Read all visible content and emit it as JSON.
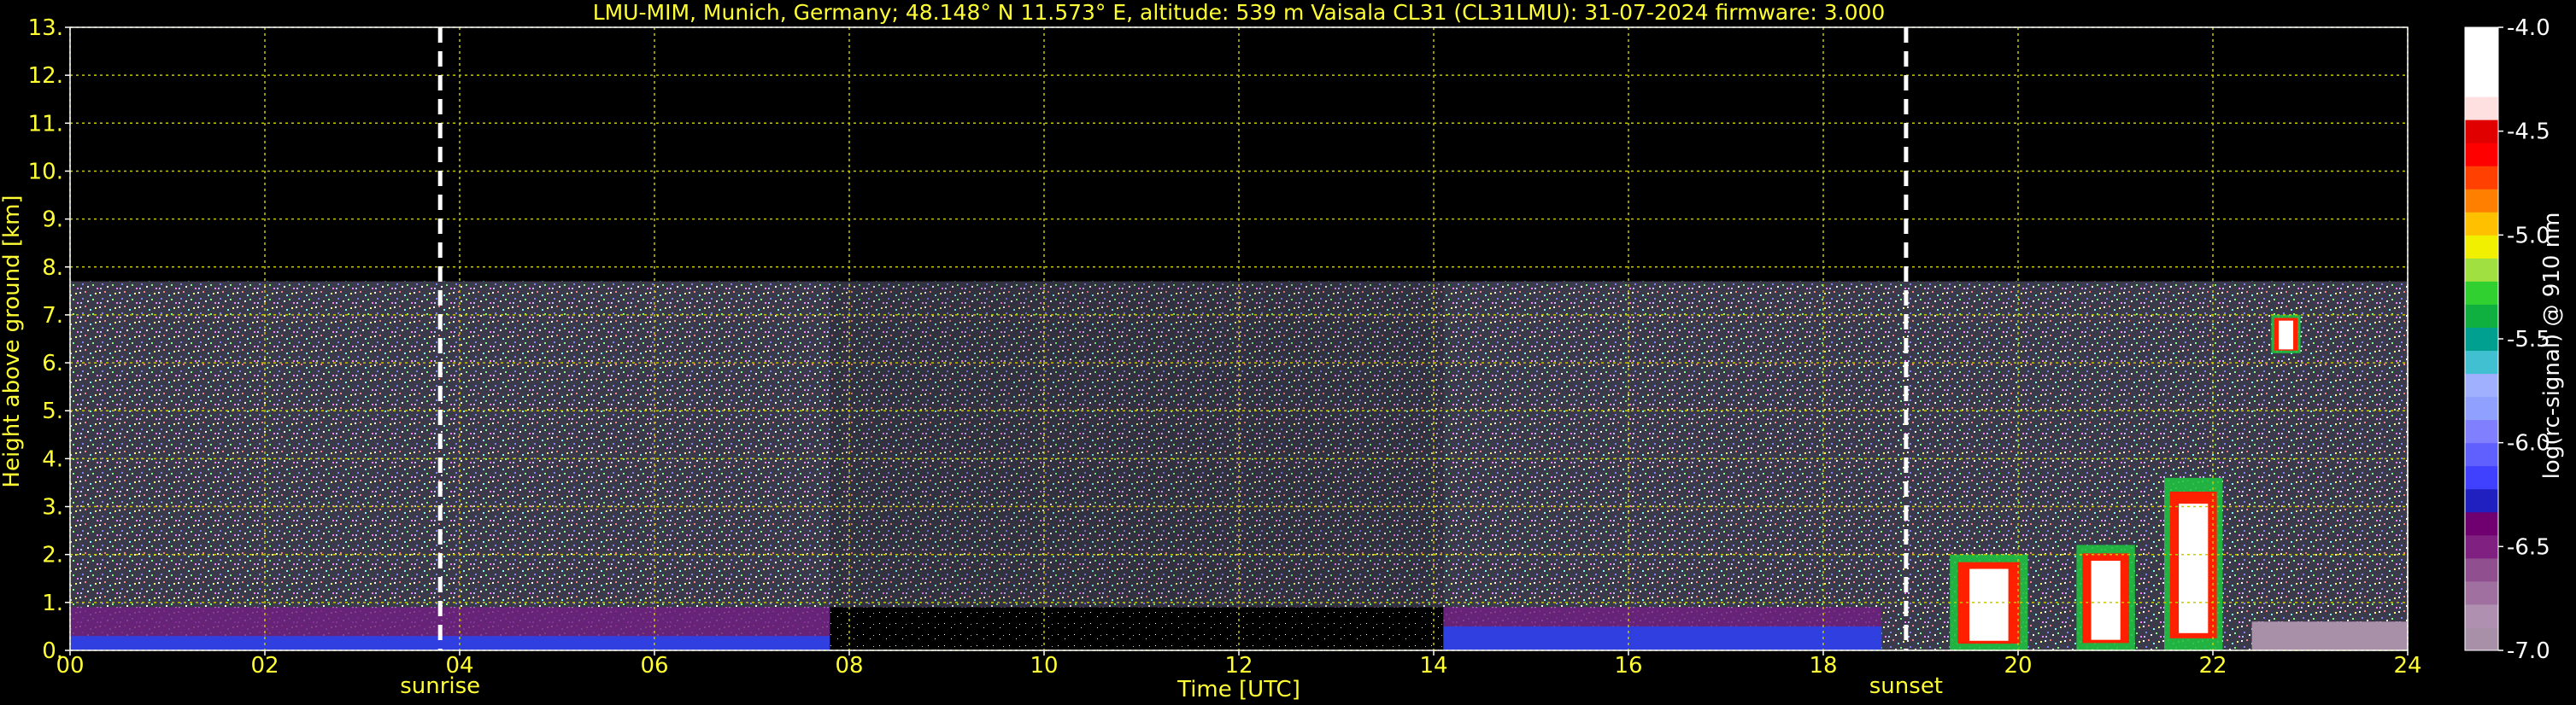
{
  "chart_data": {
    "type": "heatmap",
    "title": "LMU-MIM, Munich, Germany; 48.148° N 11.573° E, altitude: 539 m    Vaisala CL31 (CL31LMU): 31-07-2024    firmware: 3.000",
    "xlabel": "Time [UTC]",
    "ylabel": "Height above ground [km]",
    "xlim": [
      0,
      24
    ],
    "ylim": [
      0,
      13
    ],
    "x_ticks": [
      "00",
      "02",
      "04",
      "06",
      "08",
      "10",
      "12",
      "14",
      "16",
      "18",
      "20",
      "22",
      "24"
    ],
    "x_tick_values": [
      0,
      2,
      4,
      6,
      8,
      10,
      12,
      14,
      16,
      18,
      20,
      22,
      24
    ],
    "y_ticks": [
      "0.",
      "1.",
      "2.",
      "3.",
      "4.",
      "5.",
      "6.",
      "7.",
      "8.",
      "9.",
      "10.",
      "11.",
      "12.",
      "13."
    ],
    "y_tick_values": [
      0,
      1,
      2,
      3,
      4,
      5,
      6,
      7,
      8,
      9,
      10,
      11,
      12,
      13
    ],
    "grid": true,
    "grid_color": "#c8c800",
    "markers": [
      {
        "label": "sunrise",
        "x": 3.8
      },
      {
        "label": "sunset",
        "x": 18.85
      }
    ],
    "colorbar": {
      "label": "log(rc-signal) @ 910 nm",
      "range": [
        -7.0,
        -4.0
      ],
      "ticks": [
        "-4.0",
        "-4.5",
        "-5.0",
        "-5.5",
        "-6.0",
        "-6.5",
        "-7.0"
      ],
      "tick_values": [
        -4.0,
        -4.5,
        -5.0,
        -5.5,
        -6.0,
        -6.5,
        -7.0
      ],
      "colors": [
        "#a890a8",
        "#b090b0",
        "#a070a0",
        "#905090",
        "#802080",
        "#700070",
        "#2020c0",
        "#4040ff",
        "#6060ff",
        "#8080ff",
        "#90a0ff",
        "#a0b0ff",
        "#40c0d0",
        "#00a090",
        "#10b040",
        "#30d030",
        "#a0e040",
        "#f0f000",
        "#ffc000",
        "#ff8000",
        "#ff4000",
        "#ff0000",
        "#e00000",
        "#ffe0e0",
        "#ffffff",
        "#ffffff",
        "#ffffff"
      ]
    },
    "data_extent_top_km": 7.7,
    "boundary_layer": [
      {
        "x0": 0,
        "x1": 7.8,
        "top": 0.9,
        "dense_top": 0.3
      },
      {
        "x0": 14.1,
        "x1": 18.6,
        "top": 0.9,
        "dense_top": 0.5
      }
    ],
    "clouds": [
      {
        "x0": 19.3,
        "x1": 20.1,
        "y0": 0,
        "y1": 2.0
      },
      {
        "x0": 20.6,
        "x1": 21.2,
        "y0": 0,
        "y1": 2.2
      },
      {
        "x0": 21.5,
        "x1": 22.1,
        "y0": 0,
        "y1": 3.6
      },
      {
        "x0": 22.6,
        "x1": 22.9,
        "y0": 6.2,
        "y1": 7.0
      }
    ]
  }
}
